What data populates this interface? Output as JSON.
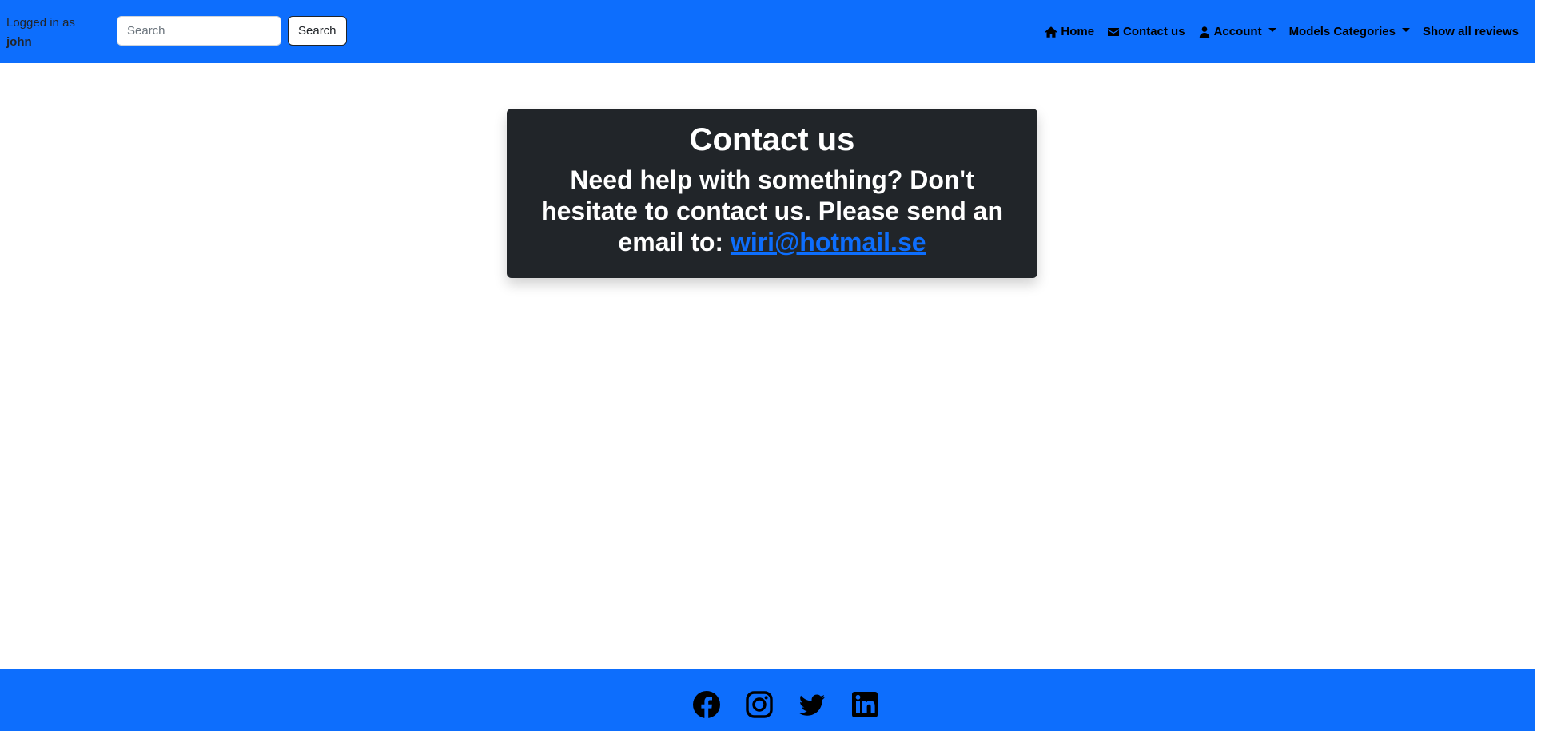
{
  "navbar": {
    "login_prefix": "Logged in as",
    "username": "john",
    "search": {
      "placeholder": "Search",
      "value": "",
      "button_label": "Search"
    },
    "links": {
      "home": {
        "label": "Home",
        "icon": "home-icon"
      },
      "contact": {
        "label": "Contact us",
        "icon": "envelope-icon"
      },
      "account": {
        "label": "Account",
        "icon": "user-icon",
        "dropdown": true
      },
      "models": {
        "label": "Models Categories",
        "dropdown": true
      },
      "reviews": {
        "label": "Show all reviews"
      }
    }
  },
  "contact_card": {
    "title": "Contact us",
    "text": "Need help with something? Don't hesitate to contact us. Please send an email to:",
    "email": "wiri@hotmail.se"
  },
  "footer": {
    "social_icons": [
      "facebook-icon",
      "instagram-icon",
      "twitter-icon",
      "linkedin-icon"
    ]
  },
  "colors": {
    "primary": "#0d6efd",
    "card_background": "#212529",
    "link": "#0d6efd",
    "text_dark": "#000000",
    "text_light": "#ffffff"
  }
}
